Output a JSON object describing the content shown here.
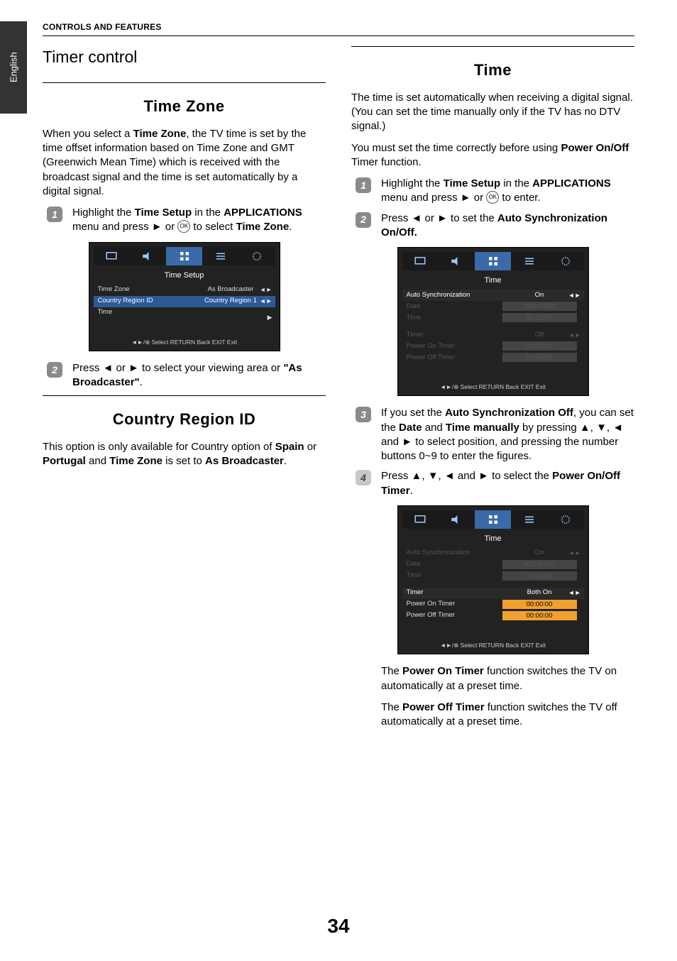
{
  "lang_tab": "English",
  "header": "CONTROLS AND FEATURES",
  "page_number": "34",
  "left": {
    "timer_control": "Timer control",
    "time_zone_title": "Time Zone",
    "tz_para": "When you select a <b>Time Zone</b>, the TV time is set by the time offset information based on Time Zone and GMT (Greenwich Mean Time) which is received with the broadcast signal and the time is set automatically by a digital signal.",
    "tz_step1": "Highlight the <b>Time Setup</b> in the <b>APPLICATIONS</b> menu and press ► or <span class=\"ok-symbol\">OK</span> to select <b>Time Zone</b>.",
    "tz_step2": "Press ◄ or ► to select your viewing area or <b>\"As Broadcaster\"</b>.",
    "country_title": "Country Region ID",
    "country_para": "This option is only available for Country option of <b>Spain</b> or <b>Portugal</b> and <b>Time Zone</b> is set to <b>As Broadcaster</b>.",
    "ss1": {
      "heading": "Time Setup",
      "rows": [
        {
          "label": "Time Zone",
          "value": "As Broadcaster",
          "arrows": true
        },
        {
          "label": "Country Region ID",
          "value": "Country Region 1",
          "highlight": true,
          "arrows": true
        },
        {
          "label": "Time",
          "value": "",
          "arrow_right": true
        }
      ],
      "footer": "◄►/⊕ Select RETURN Back EXIT Exit"
    }
  },
  "right": {
    "time_title": "Time",
    "time_para1": "The time is set automatically when receiving a digital signal. (You can set the time manually only if the TV has no DTV signal.)",
    "time_para2": "You must set the time correctly before using <b>Power On/Off</b> Timer function.",
    "step1": "Highlight the <b>Time Setup</b> in the <b>APPLICATIONS</b> menu and press ► or <span class=\"ok-symbol\">OK</span> to enter.",
    "step2": "Press ◄ or ► to set the <b>Auto Synchronization On/Off.</b>",
    "step3": "If you set the <b>Auto Synchronization Off</b>, you can set the <b>Date</b> and <b>Time manually</b> by pressing ▲, ▼, ◄ and ► to select position, and pressing the number buttons 0~9 to enter the figures.",
    "step4": "Press ▲, ▼, ◄ and ► to select the <b>Power On/Off Timer</b>.",
    "after1": "The <b>Power On Timer</b> function switches the TV on automatically at a preset time.",
    "after2": "The <b>Power Off Timer</b> function switches the TV off automatically at a preset time.",
    "ss2": {
      "heading": "Time",
      "rows1": [
        {
          "label": "Auto Synchronization",
          "value": "On",
          "arrows": true,
          "highlight_row": true
        },
        {
          "label": "Date",
          "value": "2011/01/01",
          "dim": true,
          "box": true
        },
        {
          "label": "Time",
          "value": "19:22:30",
          "dim": true,
          "box": true
        }
      ],
      "rows2": [
        {
          "label": "Timer",
          "value": "Off",
          "dim": true,
          "arrows": true
        },
        {
          "label": "Power On Timer",
          "value": "00:00:00",
          "dim": true,
          "box": true
        },
        {
          "label": "Power Off Timer",
          "value": "00:00:00",
          "dim": true,
          "box": true
        }
      ],
      "footer": "◄►/⊕ Select RETURN Back EXIT Exit"
    },
    "ss3": {
      "heading": "Time",
      "rows1": [
        {
          "label": "Auto Synchronization",
          "value": "On",
          "dim": true,
          "arrows": true
        },
        {
          "label": "Date",
          "value": "2011/01/01",
          "dim": true,
          "box": true
        },
        {
          "label": "Time",
          "value": "19:22:30",
          "dim": true,
          "box": true
        }
      ],
      "rows2": [
        {
          "label": "Timer",
          "value": "Both On",
          "arrows": true,
          "highlight_row": true
        },
        {
          "label": "Power On Timer",
          "value": "00:00:00",
          "box": true,
          "hl": true
        },
        {
          "label": "Power Off Timer",
          "value": "00:00:00",
          "box": true,
          "hl": true
        }
      ],
      "footer": "◄►/⊕ Select RETURN Back EXIT Exit"
    }
  }
}
